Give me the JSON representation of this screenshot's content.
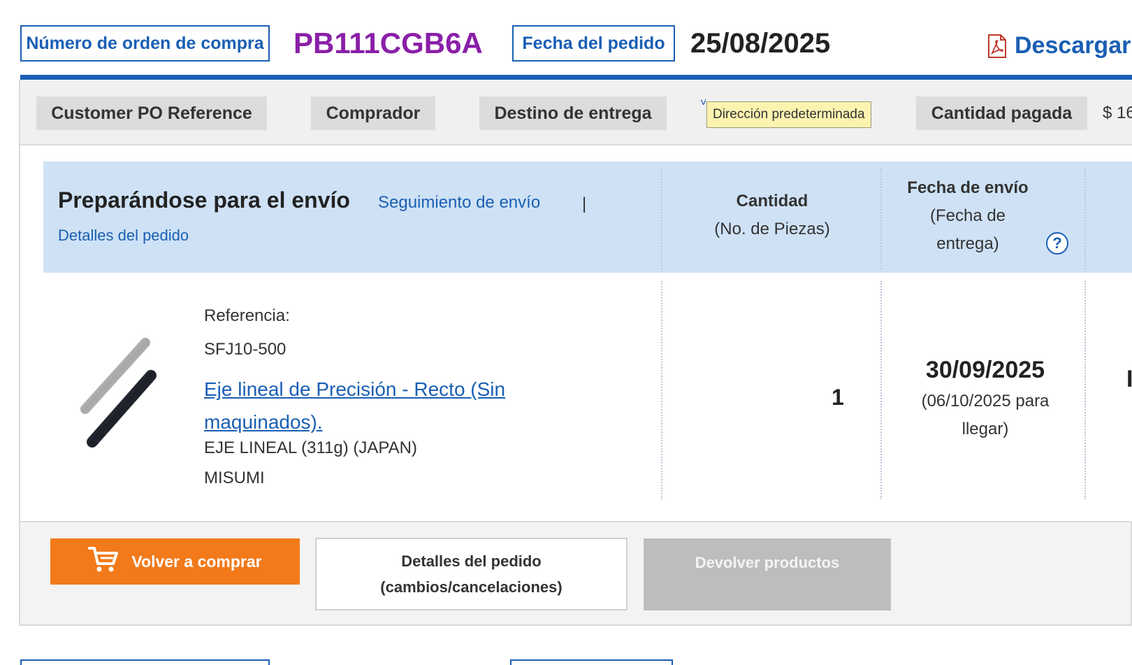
{
  "header": {
    "po_label": "Número de orden de compra",
    "po_number": "PB111CGB6A",
    "date_label": "Fecha del pedido",
    "order_date": "25/08/2025",
    "download_label": "Descargar"
  },
  "info_bar": {
    "customer_po_label": "Customer PO Reference",
    "buyer_label": "Comprador",
    "destination_label": "Destino de entrega",
    "default_address_tooltip": "Dirección predeterminada",
    "paid_label": "Cantidad pagada",
    "paid_value": "$ 16"
  },
  "order_table": {
    "status_title": "Preparándose para el envío",
    "tracking_link": "Seguimiento de envío",
    "separator": "|",
    "details_link": "Detalles del pedido",
    "qty_header": "Cantidad",
    "qty_subheader": "(No. de Piezas)",
    "ship_header": "Fecha de envío",
    "ship_subheader_1": "(Fecha de",
    "ship_subheader_2": "entrega)",
    "help_icon_text": "?"
  },
  "item": {
    "reference_label": "Referencia:",
    "reference_code": "SFJ10-500",
    "product_name": "Eje lineal de Precisión - Recto (Sin maquinados).",
    "description": "EJE LINEAL (311g) (JAPAN)",
    "manufacturer": "MISUMI",
    "quantity": "1",
    "ship_date": "30/09/2025",
    "arrival_line_1": "(06/10/2025 para",
    "arrival_line_2": "llegar)",
    "clipped_char": "I"
  },
  "actions": {
    "buy_again": "Volver a comprar",
    "details_line_1": "Detalles del pedido",
    "details_line_2": "(cambios/cancelaciones)",
    "return_products": "Devolver productos"
  },
  "colors": {
    "accent_blue": "#1a5fb4",
    "po_purple": "#8a1fa8",
    "orange": "#f27a1a",
    "band_blue": "#cfe2f5"
  },
  "icons": [
    "pdf-icon",
    "shopping-cart-icon",
    "help-icon",
    "product-shaft-image"
  ]
}
